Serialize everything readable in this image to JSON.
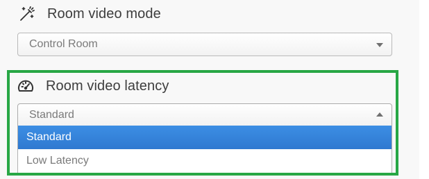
{
  "video_mode": {
    "icon": "magic-wand-icon",
    "title": "Room video mode",
    "selected_value": "Control Room"
  },
  "video_latency": {
    "icon": "gauge-icon",
    "title": "Room video latency",
    "selected_value": "Standard",
    "options": [
      {
        "label": "Standard",
        "selected": true
      },
      {
        "label": "Low Latency",
        "selected": false
      }
    ]
  },
  "colors": {
    "highlight": "#28a745",
    "selected_option": "#2f79d0"
  }
}
